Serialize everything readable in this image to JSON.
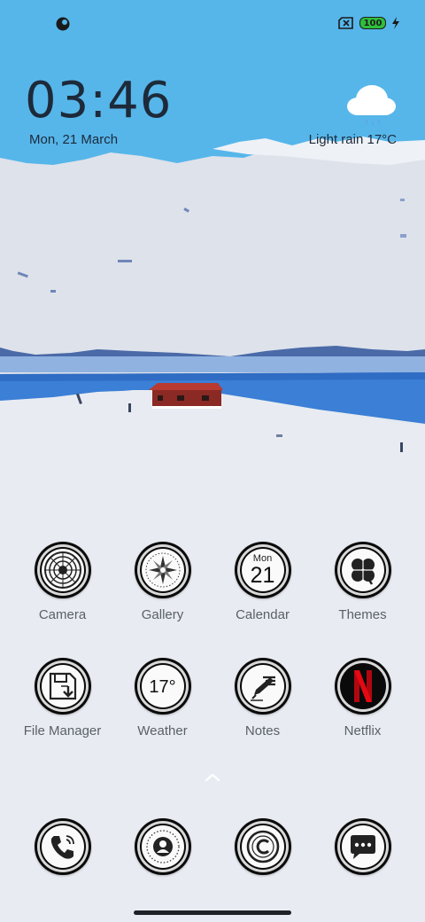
{
  "status_bar": {
    "notification_icon": "notification-app-icon",
    "sim_icon": "no-sim-icon",
    "battery_level": "100",
    "charging_icon": "charging-bolt-icon"
  },
  "clock": {
    "hour": "03",
    "separator": ":",
    "minute": "46"
  },
  "date": "Mon, 21 March",
  "weather_widget": {
    "icon": "cloud-rain-icon",
    "condition_temp": "Light rain  17°C"
  },
  "apps": [
    {
      "label": "Camera",
      "icon": "camera-lens-icon"
    },
    {
      "label": "Gallery",
      "icon": "gallery-compass-icon"
    },
    {
      "label": "Calendar",
      "icon": "calendar-icon",
      "month_day_name": "Mon",
      "day": "21"
    },
    {
      "label": "Themes",
      "icon": "clover-icon"
    },
    {
      "label": "File Manager",
      "icon": "file-download-icon"
    },
    {
      "label": "Weather",
      "icon": "weather-temp-icon",
      "temp": "17°"
    },
    {
      "label": "Notes",
      "icon": "notes-pen-icon"
    },
    {
      "label": "Netflix",
      "icon": "netflix-icon",
      "accent": "#e50914"
    }
  ],
  "dock": [
    {
      "icon": "phone-icon"
    },
    {
      "icon": "contacts-icon"
    },
    {
      "icon": "browser-copyright-icon"
    },
    {
      "icon": "messages-icon"
    }
  ],
  "app_drawer_hint": "chevron-up-icon",
  "colors": {
    "sky": "#56b6ea",
    "snow": "#e6eaf0",
    "lake": "#3b7fd6",
    "cabin": "#8b2a24",
    "ring": "#0a0a0a"
  }
}
